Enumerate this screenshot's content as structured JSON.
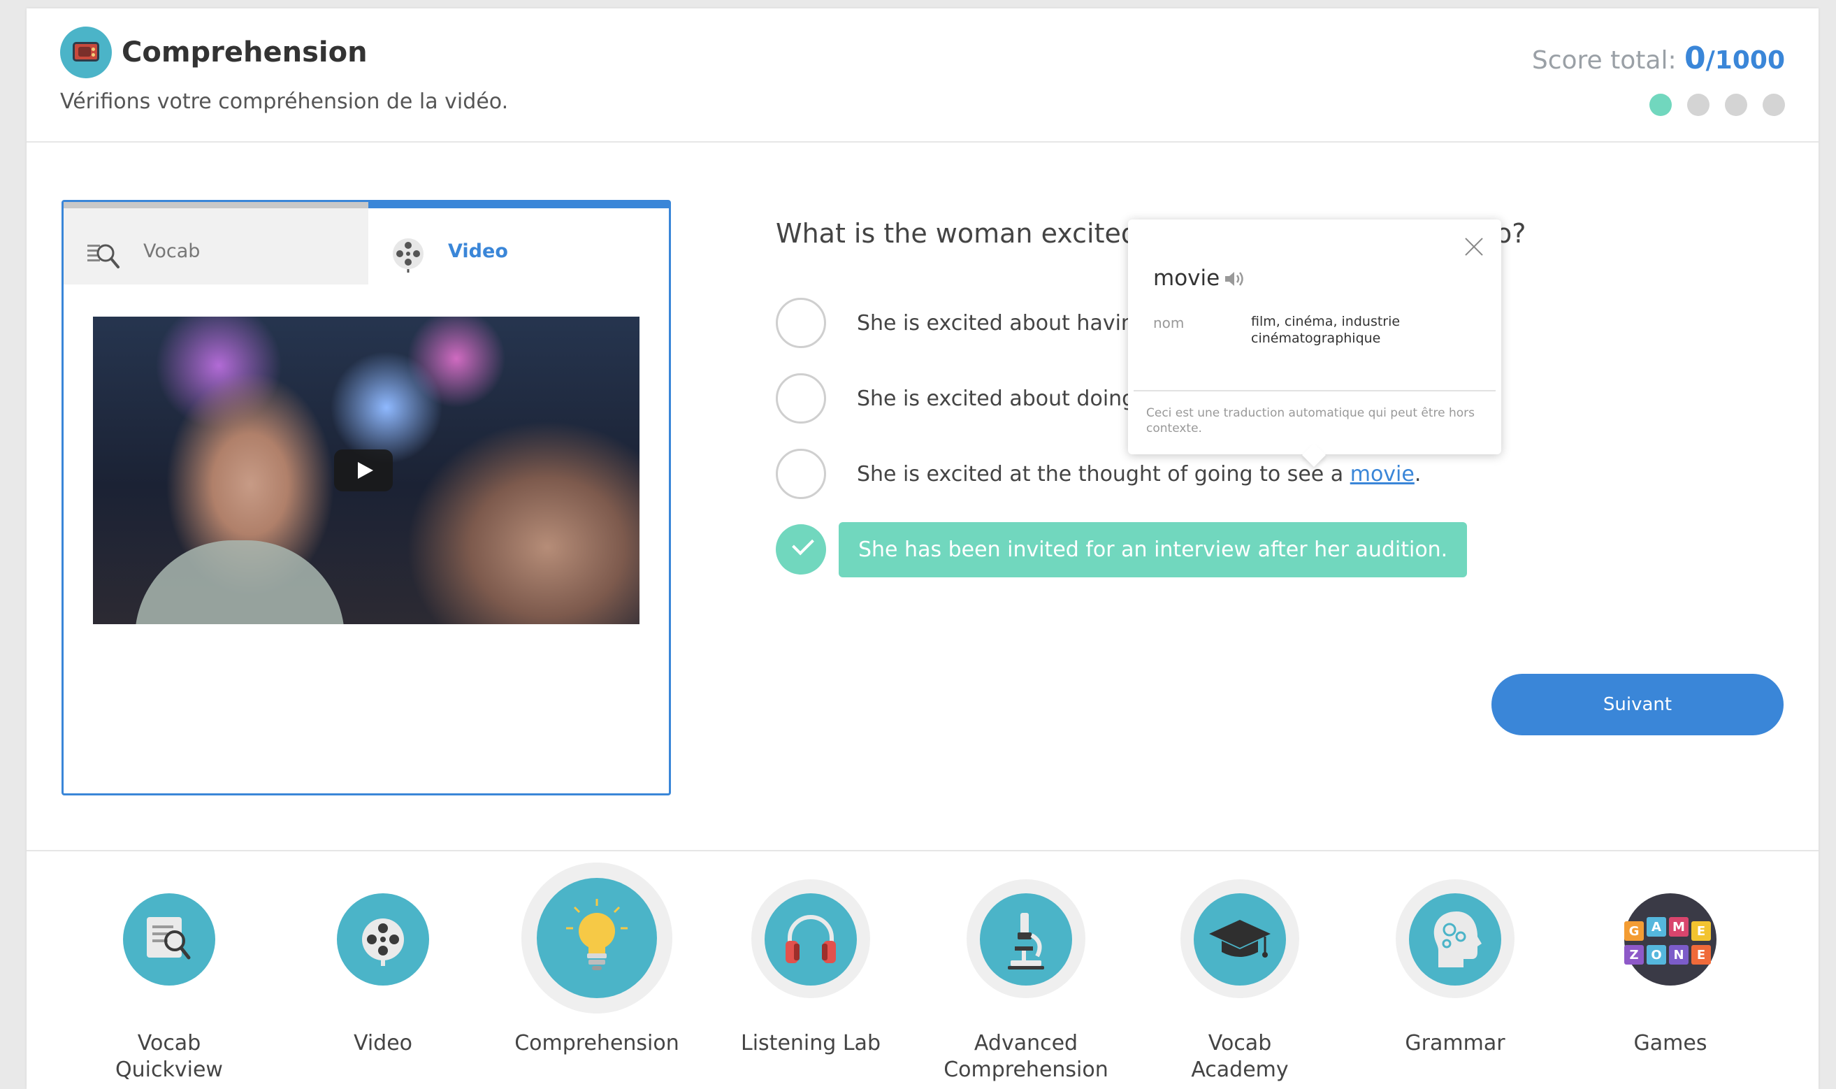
{
  "header": {
    "title": "Comprehension",
    "subtitle": "Vérifions votre compréhension de la vidéo.",
    "score_label": "Score total:",
    "score_value": "0",
    "score_max": "/1000",
    "progress": {
      "current": 1,
      "total": 4
    }
  },
  "media_panel": {
    "tabs": [
      {
        "label": "Vocab",
        "icon": "vocab-magnifier-icon",
        "active": false
      },
      {
        "label": "Video",
        "icon": "film-reel-icon",
        "active": true
      }
    ]
  },
  "question": {
    "text_before_popup": "What is the woman excited ab",
    "text_after_popup": "o?",
    "answers": [
      {
        "text": "She is excited about having sa",
        "selected": false
      },
      {
        "text": "She is excited about doing so",
        "selected": false
      },
      {
        "text_before_link": "She is excited at the thought of going to see a ",
        "link": "movie",
        "text_after_link": ".",
        "selected": false
      },
      {
        "text": "She has been invited for an interview after her audition.",
        "selected": true
      }
    ]
  },
  "popup": {
    "word": "movie",
    "part_of_speech": "nom",
    "translation": "film, cinéma, industrie cinématographique",
    "note": "Ceci est une traduction automatique qui peut être hors contexte."
  },
  "next_button": {
    "label": "Suivant"
  },
  "bottom_nav": {
    "items": [
      {
        "label_line1": "Vocab",
        "label_line2": "Quickview",
        "icon": "vocab-quickview-icon",
        "active": false
      },
      {
        "label_line1": "Video",
        "label_line2": "",
        "icon": "film-reel-icon",
        "active": false
      },
      {
        "label_line1": "Comprehension",
        "label_line2": "",
        "icon": "lightbulb-icon",
        "active": true
      },
      {
        "label_line1": "Listening Lab",
        "label_line2": "",
        "icon": "headphones-icon",
        "active": false
      },
      {
        "label_line1": "Advanced",
        "label_line2": "Comprehension",
        "icon": "microscope-icon",
        "active": false
      },
      {
        "label_line1": "Vocab",
        "label_line2": "Academy",
        "icon": "graduation-cap-icon",
        "active": false
      },
      {
        "label_line1": "Grammar",
        "label_line2": "",
        "icon": "brain-gears-icon",
        "active": false
      },
      {
        "label_line1": "Games",
        "label_line2": "",
        "icon": "game-zone-icon",
        "active": false
      }
    ],
    "game_zone_logo_text": "GAME ZONE"
  },
  "colors": {
    "accent": "#3a86d8",
    "success": "#71d7be",
    "teal": "#4bb4c8"
  }
}
